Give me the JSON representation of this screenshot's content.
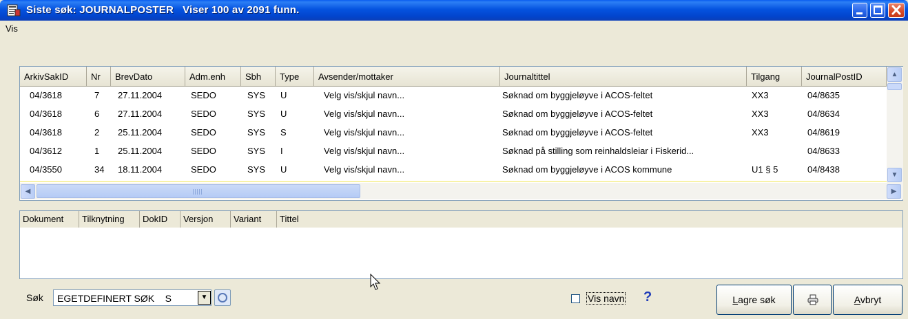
{
  "window": {
    "title": "Siste søk: JOURNALPOSTER   Viser 100 av 2091 funn.",
    "colors": {
      "title_bar": "#0553e0",
      "close": "#d64925"
    }
  },
  "menu": {
    "items": [
      "Vis"
    ]
  },
  "grid": {
    "columns": [
      "ArkivSakID",
      "Nr",
      "BrevDato",
      "Adm.enh",
      "Sbh",
      "Type",
      "Avsender/mottaker",
      "Journaltittel",
      "Tilgang",
      "JournalPostID"
    ],
    "rows": [
      [
        "04/3618",
        "7",
        "27.11.2004",
        "SEDO",
        "SYS",
        "U",
        "Velg vis/skjul navn...",
        "Søknad om byggjeløyve i ACOS-feltet",
        "XX3",
        "04/8635"
      ],
      [
        "04/3618",
        "6",
        "27.11.2004",
        "SEDO",
        "SYS",
        "U",
        "Velg vis/skjul navn...",
        "Søknad om byggjeløyve i ACOS-feltet",
        "XX3",
        "04/8634"
      ],
      [
        "04/3618",
        "2",
        "25.11.2004",
        "SEDO",
        "SYS",
        "S",
        "Velg vis/skjul navn...",
        "Søknad om byggjeløyve i ACOS-feltet",
        "XX3",
        "04/8619"
      ],
      [
        "04/3612",
        "1",
        "25.11.2004",
        "SEDO",
        "SYS",
        "I",
        "Velg vis/skjul navn...",
        "Søknad på stilling som reinhaldsleiar i Fiskerid...",
        "",
        "04/8633"
      ],
      [
        "04/3550",
        "34",
        "18.11.2004",
        "SEDO",
        "SYS",
        "U",
        "Velg vis/skjul navn...",
        "Søknad om byggjeløyve i ACOS kommune",
        "U1  § 5",
        "04/8438"
      ]
    ]
  },
  "documents": {
    "columns": [
      "Dokument",
      "Tilknytning",
      "DokID",
      "Versjon",
      "Variant",
      "Tittel"
    ]
  },
  "footer": {
    "search_label": "Søk",
    "search_value": "EGETDEFINERT SØK    S",
    "show_names_label": "Vis navn",
    "show_names_checked": false,
    "help_symbol": "?",
    "save_button": {
      "hotkey": "L",
      "rest": "agre søk"
    },
    "cancel_button": {
      "hotkey": "A",
      "rest": "vbryt"
    }
  }
}
